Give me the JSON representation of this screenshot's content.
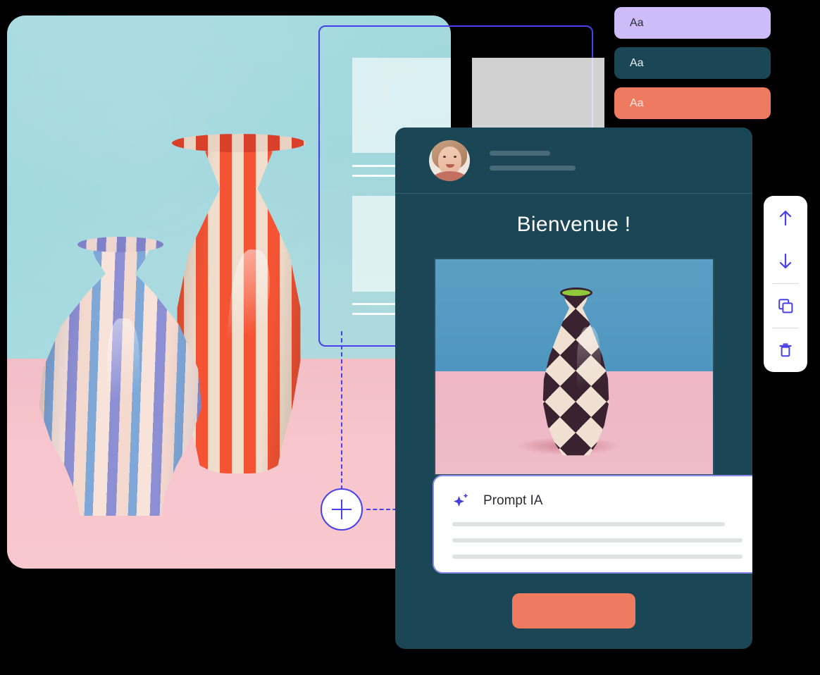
{
  "photo": {
    "alt_name": "striped-ceramic-vases-photo",
    "wall_color": "#a6dbe0",
    "floor_color": "#f4c1ca",
    "vases": [
      "coral-striped-vase",
      "pastel-wavy-vase"
    ]
  },
  "wireframe": {
    "name": "wireframe-selection-panel",
    "selection_border_color": "#4840e8"
  },
  "connector": {
    "add_node_label": "+",
    "line_color": "#4840e8"
  },
  "swatches": {
    "items": [
      {
        "label": "Aa",
        "bg": "#cdbcf7",
        "fg": "#2b2b33",
        "name": "swatch-lavender"
      },
      {
        "label": "Aa",
        "bg": "#1b4656",
        "fg": "#e8f0f2",
        "name": "swatch-teal"
      },
      {
        "label": "Aa",
        "bg": "#ee7a5f",
        "fg": "#fbe9e4",
        "name": "swatch-coral"
      }
    ]
  },
  "toolbar": {
    "accent": "#4840e8",
    "buttons": [
      {
        "name": "move-up-button",
        "icon": "arrow-up-icon"
      },
      {
        "name": "move-down-button",
        "icon": "arrow-down-icon"
      },
      {
        "name": "duplicate-button",
        "icon": "copy-icon"
      },
      {
        "name": "delete-button",
        "icon": "trash-icon"
      }
    ]
  },
  "card": {
    "bg": "#1b4656",
    "header": {
      "avatar_name": "user-avatar",
      "placeholder_lines": 2
    },
    "title": "Bienvenue !",
    "image_name": "checkered-vase-photo",
    "prompt": {
      "icon": "sparkle-icon",
      "title": "Prompt IA",
      "placeholder_lines": 3,
      "border_color": "#8b8ae8",
      "icon_color": "#4540d8"
    },
    "cta": {
      "name": "primary-cta-button",
      "label": "",
      "color": "#ee7a5f"
    }
  }
}
